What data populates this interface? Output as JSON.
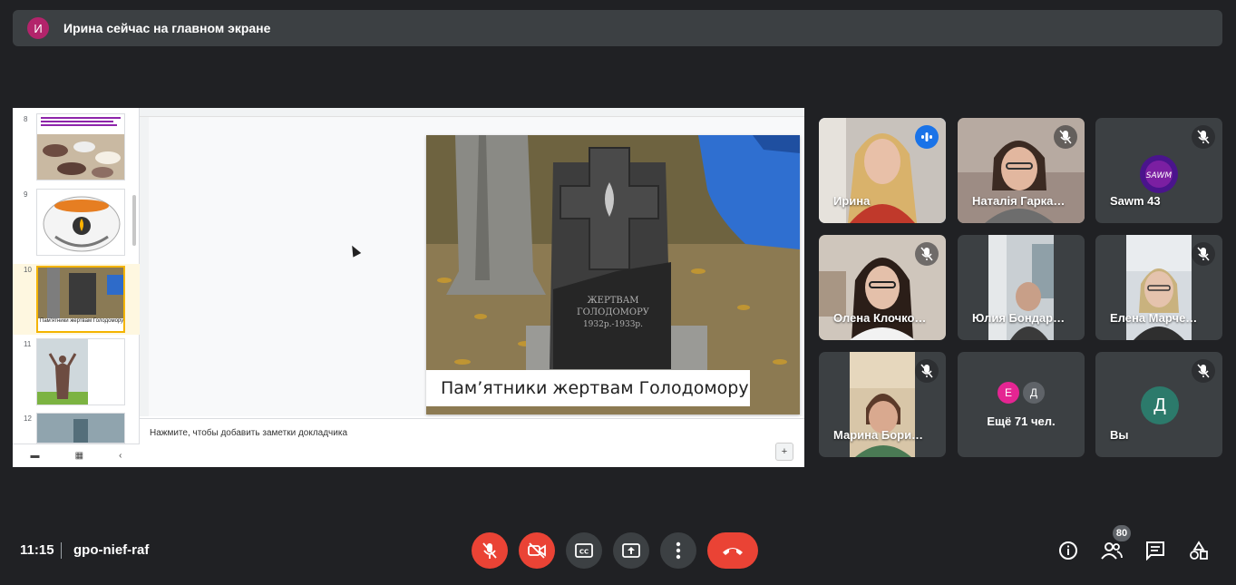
{
  "banner": {
    "avatar_initial": "И",
    "text": "Ирина сейчас на главном экране"
  },
  "presentation": {
    "thumbnails": [
      {
        "number": "8",
        "caption": ""
      },
      {
        "number": "9",
        "caption": ""
      },
      {
        "number": "10",
        "caption": "Пам'ятники жертвам Голодомору"
      },
      {
        "number": "11",
        "caption": ""
      },
      {
        "number": "12",
        "caption": ""
      }
    ],
    "slide": {
      "caption": "Пам’ятники жертвам Голодомору",
      "monument_line1": "ЖЕРТВАМ",
      "monument_line2": "ГОЛОДОМОРУ",
      "monument_line3": "1932р.-1933р."
    },
    "notes_placeholder": "Нажмите, чтобы добавить заметки докладчика"
  },
  "participants": [
    {
      "name": "Ирина",
      "speaking": true
    },
    {
      "name": "Наталія Гарка…",
      "speaking": false
    },
    {
      "name": "Sawm 43",
      "speaking": false
    },
    {
      "name": "Олена Клочко…",
      "speaking": false
    },
    {
      "name": "Юлия Бондар…",
      "speaking": false
    },
    {
      "name": "Елена Марче…",
      "speaking": false
    },
    {
      "name": "Марина Бори…",
      "speaking": false
    },
    {
      "more_label": "Ещё 71 чел.",
      "avatars": [
        "Е",
        "Д"
      ],
      "avatar_colors": [
        "#e52592",
        "#5f6368"
      ]
    },
    {
      "name": "Вы",
      "avatar_initial": "Д",
      "avatar_color": "#2c7a6b"
    }
  ],
  "bottom_bar": {
    "time": "11:15",
    "meeting_code": "gpo-nief-raf",
    "people_count": "80"
  },
  "colors": {
    "accent_red": "#ea4335",
    "speaking_blue": "#8ab4f8",
    "tile_bg": "#3c4043"
  }
}
